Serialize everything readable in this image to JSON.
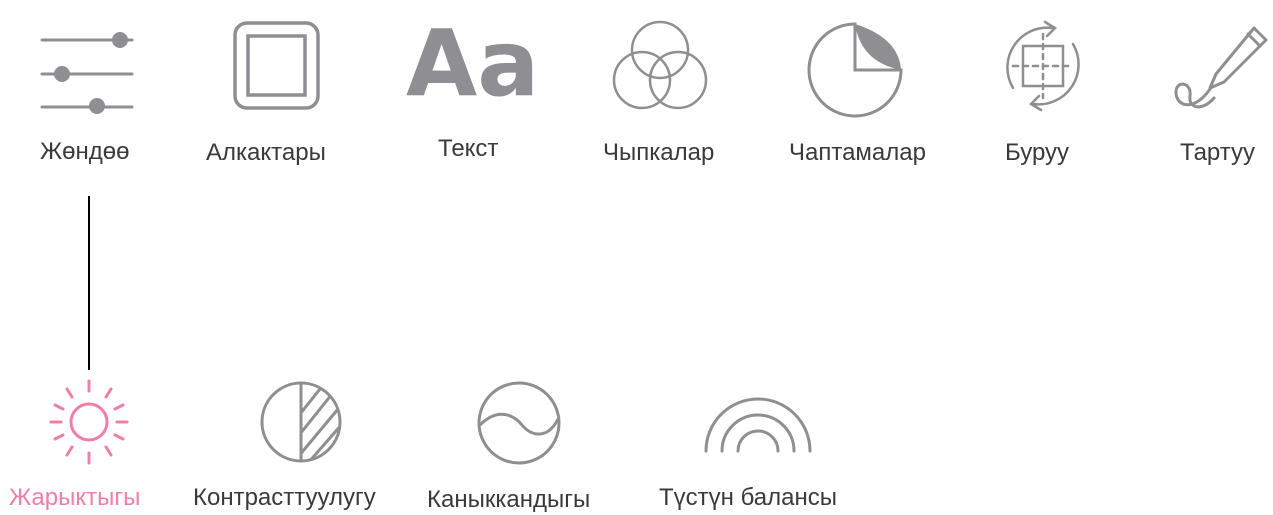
{
  "colors": {
    "icon_gray": "#8e8e93",
    "label_text": "#3a3a3a",
    "active_accent": "#ef7fa6",
    "connector": "#000000"
  },
  "tools": [
    {
      "id": "adjust",
      "label": "Жөндөө",
      "icon": "sliders-icon"
    },
    {
      "id": "frames",
      "label": "Алкактары",
      "icon": "frame-icon"
    },
    {
      "id": "text",
      "label": "Текст",
      "icon": "text-aa-icon",
      "glyph": "Aa"
    },
    {
      "id": "filters",
      "label": "Чыпкалар",
      "icon": "filters-icon"
    },
    {
      "id": "stickers",
      "label": "Чаптамалар",
      "icon": "sticker-icon"
    },
    {
      "id": "rotate",
      "label": "Буруу",
      "icon": "rotate-icon"
    },
    {
      "id": "draw",
      "label": "Тартуу",
      "icon": "pencil-icon"
    }
  ],
  "adjust_options": [
    {
      "id": "brightness",
      "label": "Жарыктыгы",
      "icon": "sun-icon",
      "active": true
    },
    {
      "id": "contrast",
      "label": "Контрасттуулугу",
      "icon": "contrast-icon",
      "active": false
    },
    {
      "id": "saturation",
      "label": "Каныккандыгы",
      "icon": "saturation-icon",
      "active": false
    },
    {
      "id": "color_balance",
      "label": "Түстүн балансы",
      "icon": "color-balance-icon",
      "active": false
    }
  ]
}
